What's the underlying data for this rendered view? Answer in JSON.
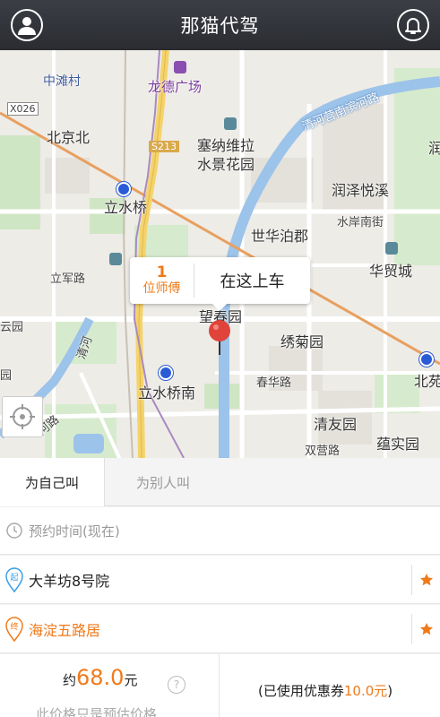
{
  "header": {
    "title": "那猫代驾"
  },
  "map": {
    "labels": {
      "zhongtan": "中滩村",
      "longde": "龙德广场",
      "x026": "X026",
      "binhe": "清河营南滨河路",
      "beijingbei": "北京北",
      "s213": "S213",
      "saina": "塞纳维拉",
      "saina2": "水景花园",
      "run": "润",
      "runze": "润泽悦溪",
      "lishuiqiao": "立水桥",
      "shuian": "水岸南街",
      "shihua": "世华泊郡",
      "huamao": "华贸城",
      "lijun": "立军路",
      "wangchun": "望春园",
      "xiuju": "绣菊园",
      "yunyuan": "云园",
      "qinghe": "清河",
      "beiyuan": "北苑",
      "yuan": "园",
      "lishuiqiaonan": "立水桥南",
      "chunhua": "春华路",
      "qingyou": "清友园",
      "yunshi": "蕴实园",
      "shuangying": "双营路",
      "hexi": "河路"
    },
    "callout": {
      "driver_count": "1",
      "driver_label": "位师傅",
      "board_label": "在这上车"
    }
  },
  "tabs": {
    "self": "为自己叫",
    "others": "为别人叫"
  },
  "order": {
    "time": "预约时间(现在)",
    "start": "大羊坊8号院",
    "end": "海淀五路居",
    "start_badge": "起",
    "end_badge": "终"
  },
  "pricing": {
    "prefix": "约",
    "amount": "68.0",
    "unit": "元",
    "help": "?",
    "note": "此价格只是预估价格",
    "coupon_prefix": "(已使用优惠券",
    "coupon_amount": "10.0元",
    "coupon_suffix": ")"
  },
  "colors": {
    "accent": "#f07a1a",
    "start_icon": "#3aa0e8",
    "header": "#2f3237"
  }
}
